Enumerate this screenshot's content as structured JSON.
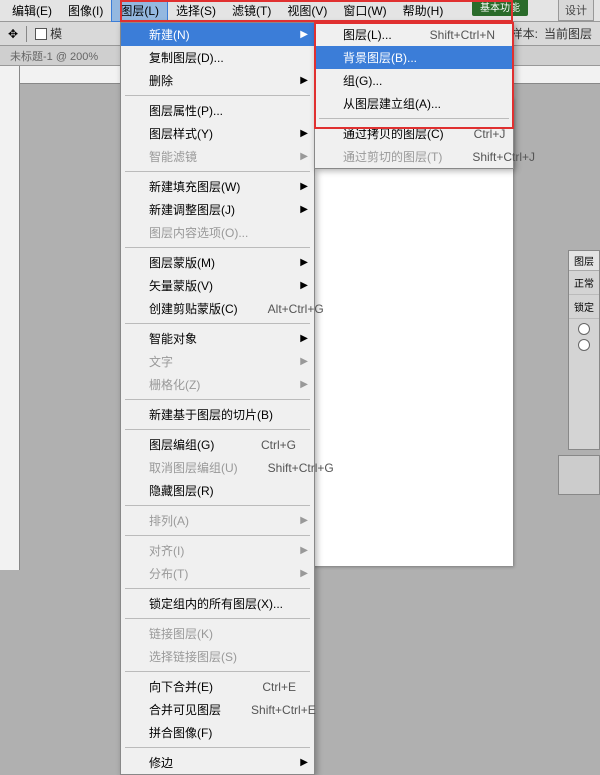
{
  "top_button": "基本功能",
  "design_tab": "设计",
  "menubar": {
    "items": [
      "编辑(E)",
      "图像(I)",
      "图层(L)",
      "选择(S)",
      "滤镜(T)",
      "视图(V)",
      "窗口(W)",
      "帮助(H)"
    ],
    "active_index": 2
  },
  "toolbar": {
    "mode_label": "模",
    "sample_label": "样本:",
    "sample_value": "当前图层"
  },
  "doc_tab": "未标题-1 @ 200%",
  "menu_layer": [
    {
      "label": "新建(N)",
      "hilite": true,
      "sub": true
    },
    {
      "label": "复制图层(D)...",
      "sub": false
    },
    {
      "label": "删除",
      "sub": true
    },
    {
      "sep": true
    },
    {
      "label": "图层属性(P)...",
      "sub": false
    },
    {
      "label": "图层样式(Y)",
      "sub": true
    },
    {
      "label": "智能滤镜",
      "disabled": true,
      "sub": true
    },
    {
      "sep": true
    },
    {
      "label": "新建填充图层(W)",
      "sub": true
    },
    {
      "label": "新建调整图层(J)",
      "sub": true
    },
    {
      "label": "图层内容选项(O)...",
      "disabled": true
    },
    {
      "sep": true
    },
    {
      "label": "图层蒙版(M)",
      "sub": true
    },
    {
      "label": "矢量蒙版(V)",
      "sub": true
    },
    {
      "label": "创建剪贴蒙版(C)",
      "shortcut": "Alt+Ctrl+G"
    },
    {
      "sep": true
    },
    {
      "label": "智能对象",
      "sub": true
    },
    {
      "label": "文字",
      "disabled": true,
      "sub": true
    },
    {
      "label": "栅格化(Z)",
      "disabled": true,
      "sub": true
    },
    {
      "sep": true
    },
    {
      "label": "新建基于图层的切片(B)"
    },
    {
      "sep": true
    },
    {
      "label": "图层编组(G)",
      "shortcut": "Ctrl+G"
    },
    {
      "label": "取消图层编组(U)",
      "shortcut": "Shift+Ctrl+G",
      "disabled": true
    },
    {
      "label": "隐藏图层(R)"
    },
    {
      "sep": true
    },
    {
      "label": "排列(A)",
      "disabled": true,
      "sub": true
    },
    {
      "sep": true
    },
    {
      "label": "对齐(I)",
      "disabled": true,
      "sub": true
    },
    {
      "label": "分布(T)",
      "disabled": true,
      "sub": true
    },
    {
      "sep": true
    },
    {
      "label": "锁定组内的所有图层(X)..."
    },
    {
      "sep": true
    },
    {
      "label": "链接图层(K)",
      "disabled": true
    },
    {
      "label": "选择链接图层(S)",
      "disabled": true
    },
    {
      "sep": true
    },
    {
      "label": "向下合并(E)",
      "shortcut": "Ctrl+E"
    },
    {
      "label": "合并可见图层",
      "shortcut": "Shift+Ctrl+E"
    },
    {
      "label": "拼合图像(F)"
    },
    {
      "sep": true
    },
    {
      "label": "修边",
      "sub": true
    }
  ],
  "menu_new": [
    {
      "label": "图层(L)...",
      "shortcut": "Shift+Ctrl+N"
    },
    {
      "label": "背景图层(B)...",
      "hilite": true
    },
    {
      "label": "组(G)..."
    },
    {
      "label": "从图层建立组(A)..."
    },
    {
      "sep": true
    },
    {
      "label": "通过拷贝的图层(C)",
      "shortcut": "Ctrl+J"
    },
    {
      "label": "通过剪切的图层(T)",
      "shortcut": "Shift+Ctrl+J",
      "disabled": true
    }
  ],
  "panel": {
    "tab": "图层",
    "mode": "正常",
    "lock": "锁定"
  }
}
